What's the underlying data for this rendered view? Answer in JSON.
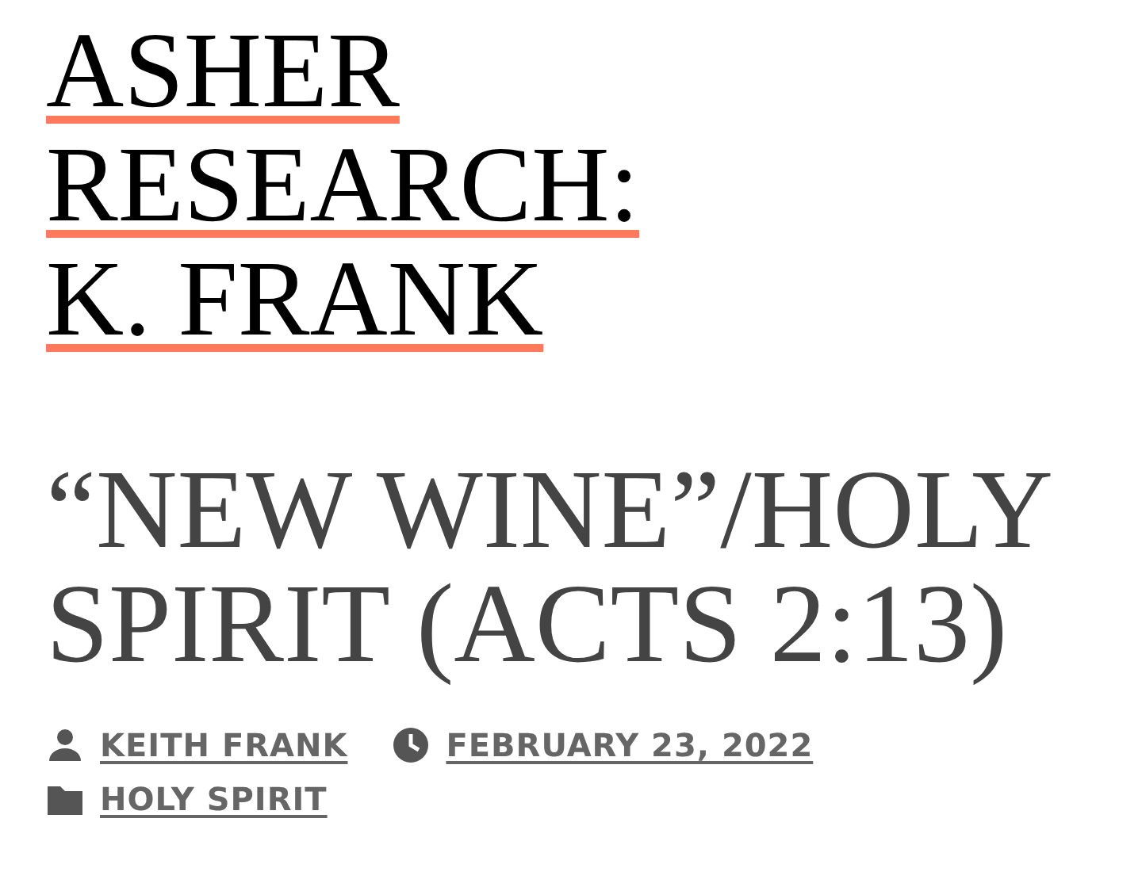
{
  "site_title": "ASHER RESEARCH: K. FRANK",
  "post": {
    "title": "“NEW WINE”/HOLY SPIRIT (ACTS 2:13)",
    "meta": [
      {
        "kind": "author",
        "text": "KEITH FRANK"
      },
      {
        "kind": "date",
        "text": "FEBRUARY 23, 2022"
      },
      {
        "kind": "category",
        "text": "HOLY SPIRIT"
      }
    ]
  }
}
